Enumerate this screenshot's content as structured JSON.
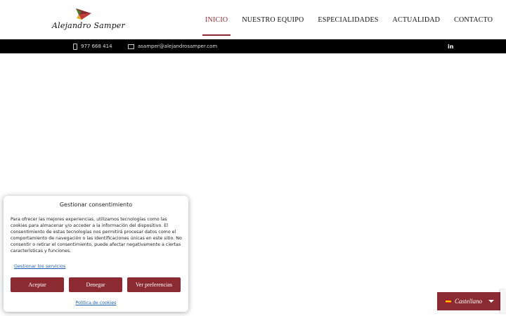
{
  "header": {
    "logo_text": "Alejandro Samper",
    "nav": [
      {
        "label": "INICIO",
        "active": true
      },
      {
        "label": "NUESTRO EQUIPO",
        "active": false
      },
      {
        "label": "ESPECIALIDADES",
        "active": false
      },
      {
        "label": "ACTUALIDAD",
        "active": false
      },
      {
        "label": "CONTACTO",
        "active": false
      }
    ]
  },
  "topbar": {
    "phone": "977 668 414",
    "email": "asamper@alejandrosamper.com",
    "linkedin": "in"
  },
  "cookie_modal": {
    "title": "Gestionar consentimiento",
    "text": "Para ofrecer las mejores experiencias, utilizamos tecnologías como las cookies para almacenar y/o acceder a la información del dispositivo. El consentimiento de estas tecnologías nos permitirá procesar datos como el comportamiento de navegación o las identificaciones únicas en este sitio. No consentir o retirar el consentimiento, puede afectar negativamente a ciertas características y funciones.",
    "manage_link": "Gestionar los servicios",
    "accept": "Aceptar",
    "deny": "Denegar",
    "preferences": "Ver preferencias",
    "policy_link": "Política de cookies"
  },
  "language": {
    "label": "Castellano"
  },
  "colors": {
    "accent": "#8b2a31",
    "topbar": "#000000"
  }
}
